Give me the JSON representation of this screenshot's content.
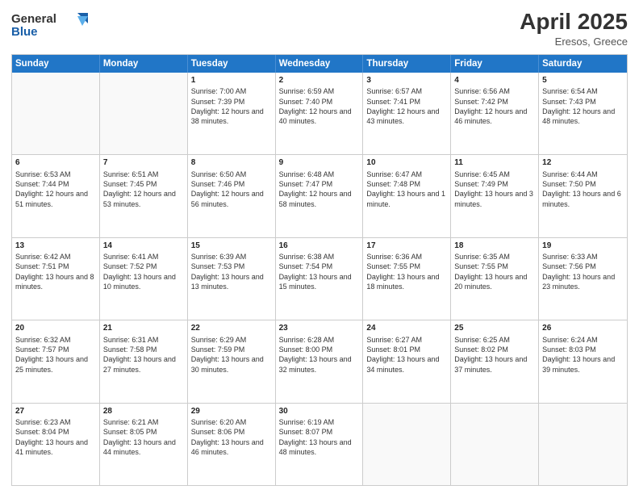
{
  "header": {
    "logo_general": "General",
    "logo_blue": "Blue",
    "month_title": "April 2025",
    "location": "Eresos, Greece"
  },
  "days_of_week": [
    "Sunday",
    "Monday",
    "Tuesday",
    "Wednesday",
    "Thursday",
    "Friday",
    "Saturday"
  ],
  "weeks": [
    [
      {
        "day": "",
        "info": ""
      },
      {
        "day": "",
        "info": ""
      },
      {
        "day": "1",
        "info": "Sunrise: 7:00 AM\nSunset: 7:39 PM\nDaylight: 12 hours and 38 minutes."
      },
      {
        "day": "2",
        "info": "Sunrise: 6:59 AM\nSunset: 7:40 PM\nDaylight: 12 hours and 40 minutes."
      },
      {
        "day": "3",
        "info": "Sunrise: 6:57 AM\nSunset: 7:41 PM\nDaylight: 12 hours and 43 minutes."
      },
      {
        "day": "4",
        "info": "Sunrise: 6:56 AM\nSunset: 7:42 PM\nDaylight: 12 hours and 46 minutes."
      },
      {
        "day": "5",
        "info": "Sunrise: 6:54 AM\nSunset: 7:43 PM\nDaylight: 12 hours and 48 minutes."
      }
    ],
    [
      {
        "day": "6",
        "info": "Sunrise: 6:53 AM\nSunset: 7:44 PM\nDaylight: 12 hours and 51 minutes."
      },
      {
        "day": "7",
        "info": "Sunrise: 6:51 AM\nSunset: 7:45 PM\nDaylight: 12 hours and 53 minutes."
      },
      {
        "day": "8",
        "info": "Sunrise: 6:50 AM\nSunset: 7:46 PM\nDaylight: 12 hours and 56 minutes."
      },
      {
        "day": "9",
        "info": "Sunrise: 6:48 AM\nSunset: 7:47 PM\nDaylight: 12 hours and 58 minutes."
      },
      {
        "day": "10",
        "info": "Sunrise: 6:47 AM\nSunset: 7:48 PM\nDaylight: 13 hours and 1 minute."
      },
      {
        "day": "11",
        "info": "Sunrise: 6:45 AM\nSunset: 7:49 PM\nDaylight: 13 hours and 3 minutes."
      },
      {
        "day": "12",
        "info": "Sunrise: 6:44 AM\nSunset: 7:50 PM\nDaylight: 13 hours and 6 minutes."
      }
    ],
    [
      {
        "day": "13",
        "info": "Sunrise: 6:42 AM\nSunset: 7:51 PM\nDaylight: 13 hours and 8 minutes."
      },
      {
        "day": "14",
        "info": "Sunrise: 6:41 AM\nSunset: 7:52 PM\nDaylight: 13 hours and 10 minutes."
      },
      {
        "day": "15",
        "info": "Sunrise: 6:39 AM\nSunset: 7:53 PM\nDaylight: 13 hours and 13 minutes."
      },
      {
        "day": "16",
        "info": "Sunrise: 6:38 AM\nSunset: 7:54 PM\nDaylight: 13 hours and 15 minutes."
      },
      {
        "day": "17",
        "info": "Sunrise: 6:36 AM\nSunset: 7:55 PM\nDaylight: 13 hours and 18 minutes."
      },
      {
        "day": "18",
        "info": "Sunrise: 6:35 AM\nSunset: 7:55 PM\nDaylight: 13 hours and 20 minutes."
      },
      {
        "day": "19",
        "info": "Sunrise: 6:33 AM\nSunset: 7:56 PM\nDaylight: 13 hours and 23 minutes."
      }
    ],
    [
      {
        "day": "20",
        "info": "Sunrise: 6:32 AM\nSunset: 7:57 PM\nDaylight: 13 hours and 25 minutes."
      },
      {
        "day": "21",
        "info": "Sunrise: 6:31 AM\nSunset: 7:58 PM\nDaylight: 13 hours and 27 minutes."
      },
      {
        "day": "22",
        "info": "Sunrise: 6:29 AM\nSunset: 7:59 PM\nDaylight: 13 hours and 30 minutes."
      },
      {
        "day": "23",
        "info": "Sunrise: 6:28 AM\nSunset: 8:00 PM\nDaylight: 13 hours and 32 minutes."
      },
      {
        "day": "24",
        "info": "Sunrise: 6:27 AM\nSunset: 8:01 PM\nDaylight: 13 hours and 34 minutes."
      },
      {
        "day": "25",
        "info": "Sunrise: 6:25 AM\nSunset: 8:02 PM\nDaylight: 13 hours and 37 minutes."
      },
      {
        "day": "26",
        "info": "Sunrise: 6:24 AM\nSunset: 8:03 PM\nDaylight: 13 hours and 39 minutes."
      }
    ],
    [
      {
        "day": "27",
        "info": "Sunrise: 6:23 AM\nSunset: 8:04 PM\nDaylight: 13 hours and 41 minutes."
      },
      {
        "day": "28",
        "info": "Sunrise: 6:21 AM\nSunset: 8:05 PM\nDaylight: 13 hours and 44 minutes."
      },
      {
        "day": "29",
        "info": "Sunrise: 6:20 AM\nSunset: 8:06 PM\nDaylight: 13 hours and 46 minutes."
      },
      {
        "day": "30",
        "info": "Sunrise: 6:19 AM\nSunset: 8:07 PM\nDaylight: 13 hours and 48 minutes."
      },
      {
        "day": "",
        "info": ""
      },
      {
        "day": "",
        "info": ""
      },
      {
        "day": "",
        "info": ""
      }
    ]
  ]
}
